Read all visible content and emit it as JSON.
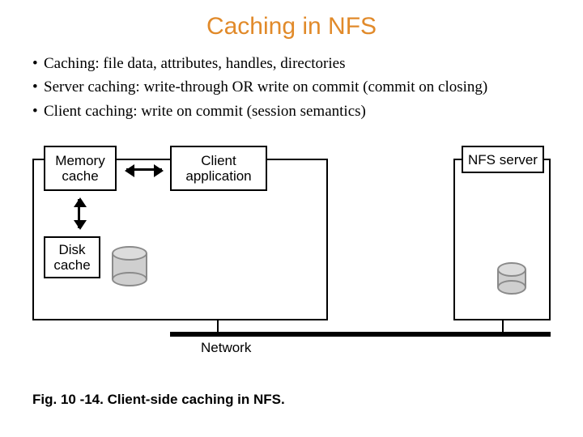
{
  "title": "Caching in NFS",
  "bullets": [
    "Caching: file data, attributes, handles, directories",
    "Server caching: write-through OR write on commit (commit on closing)",
    "Client caching: write on commit (session semantics)"
  ],
  "diagram": {
    "memory_cache": "Memory\ncache",
    "client_application": "Client\napplication",
    "nfs_server": "NFS server",
    "disk_cache": "Disk\ncache",
    "network": "Network"
  },
  "caption": "Fig. 10 -14. Client-side caching in NFS."
}
